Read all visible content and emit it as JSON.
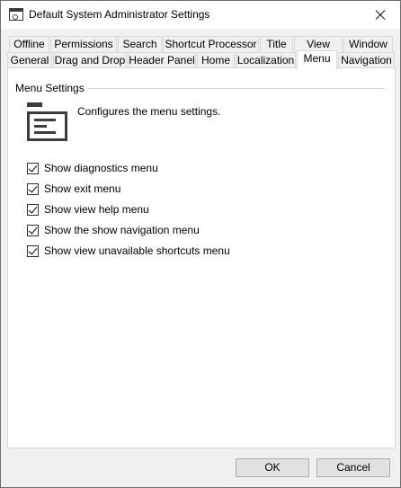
{
  "window": {
    "title": "Default System Administrator Settings"
  },
  "tabs_row1": [
    {
      "label": "Offline"
    },
    {
      "label": "Permissions"
    },
    {
      "label": "Search"
    },
    {
      "label": "Shortcut Processor"
    },
    {
      "label": "Title"
    },
    {
      "label": "View"
    },
    {
      "label": "Window"
    }
  ],
  "tabs_row2": [
    {
      "label": "General"
    },
    {
      "label": "Drag and Drop"
    },
    {
      "label": "Header Panel"
    },
    {
      "label": "Home"
    },
    {
      "label": "Localization"
    },
    {
      "label": "Menu",
      "selected": true
    },
    {
      "label": "Navigation"
    }
  ],
  "group": {
    "title": "Menu Settings",
    "icon": "menu-settings-icon",
    "description": "Configures the menu settings."
  },
  "options": [
    {
      "label": "Show diagnostics menu",
      "checked": true
    },
    {
      "label": "Show exit menu",
      "checked": true
    },
    {
      "label": "Show view help menu",
      "checked": true
    },
    {
      "label": "Show the show navigation menu",
      "checked": true
    },
    {
      "label": "Show view unavailable shortcuts menu",
      "checked": true
    }
  ],
  "buttons": {
    "ok": "OK",
    "cancel": "Cancel"
  }
}
